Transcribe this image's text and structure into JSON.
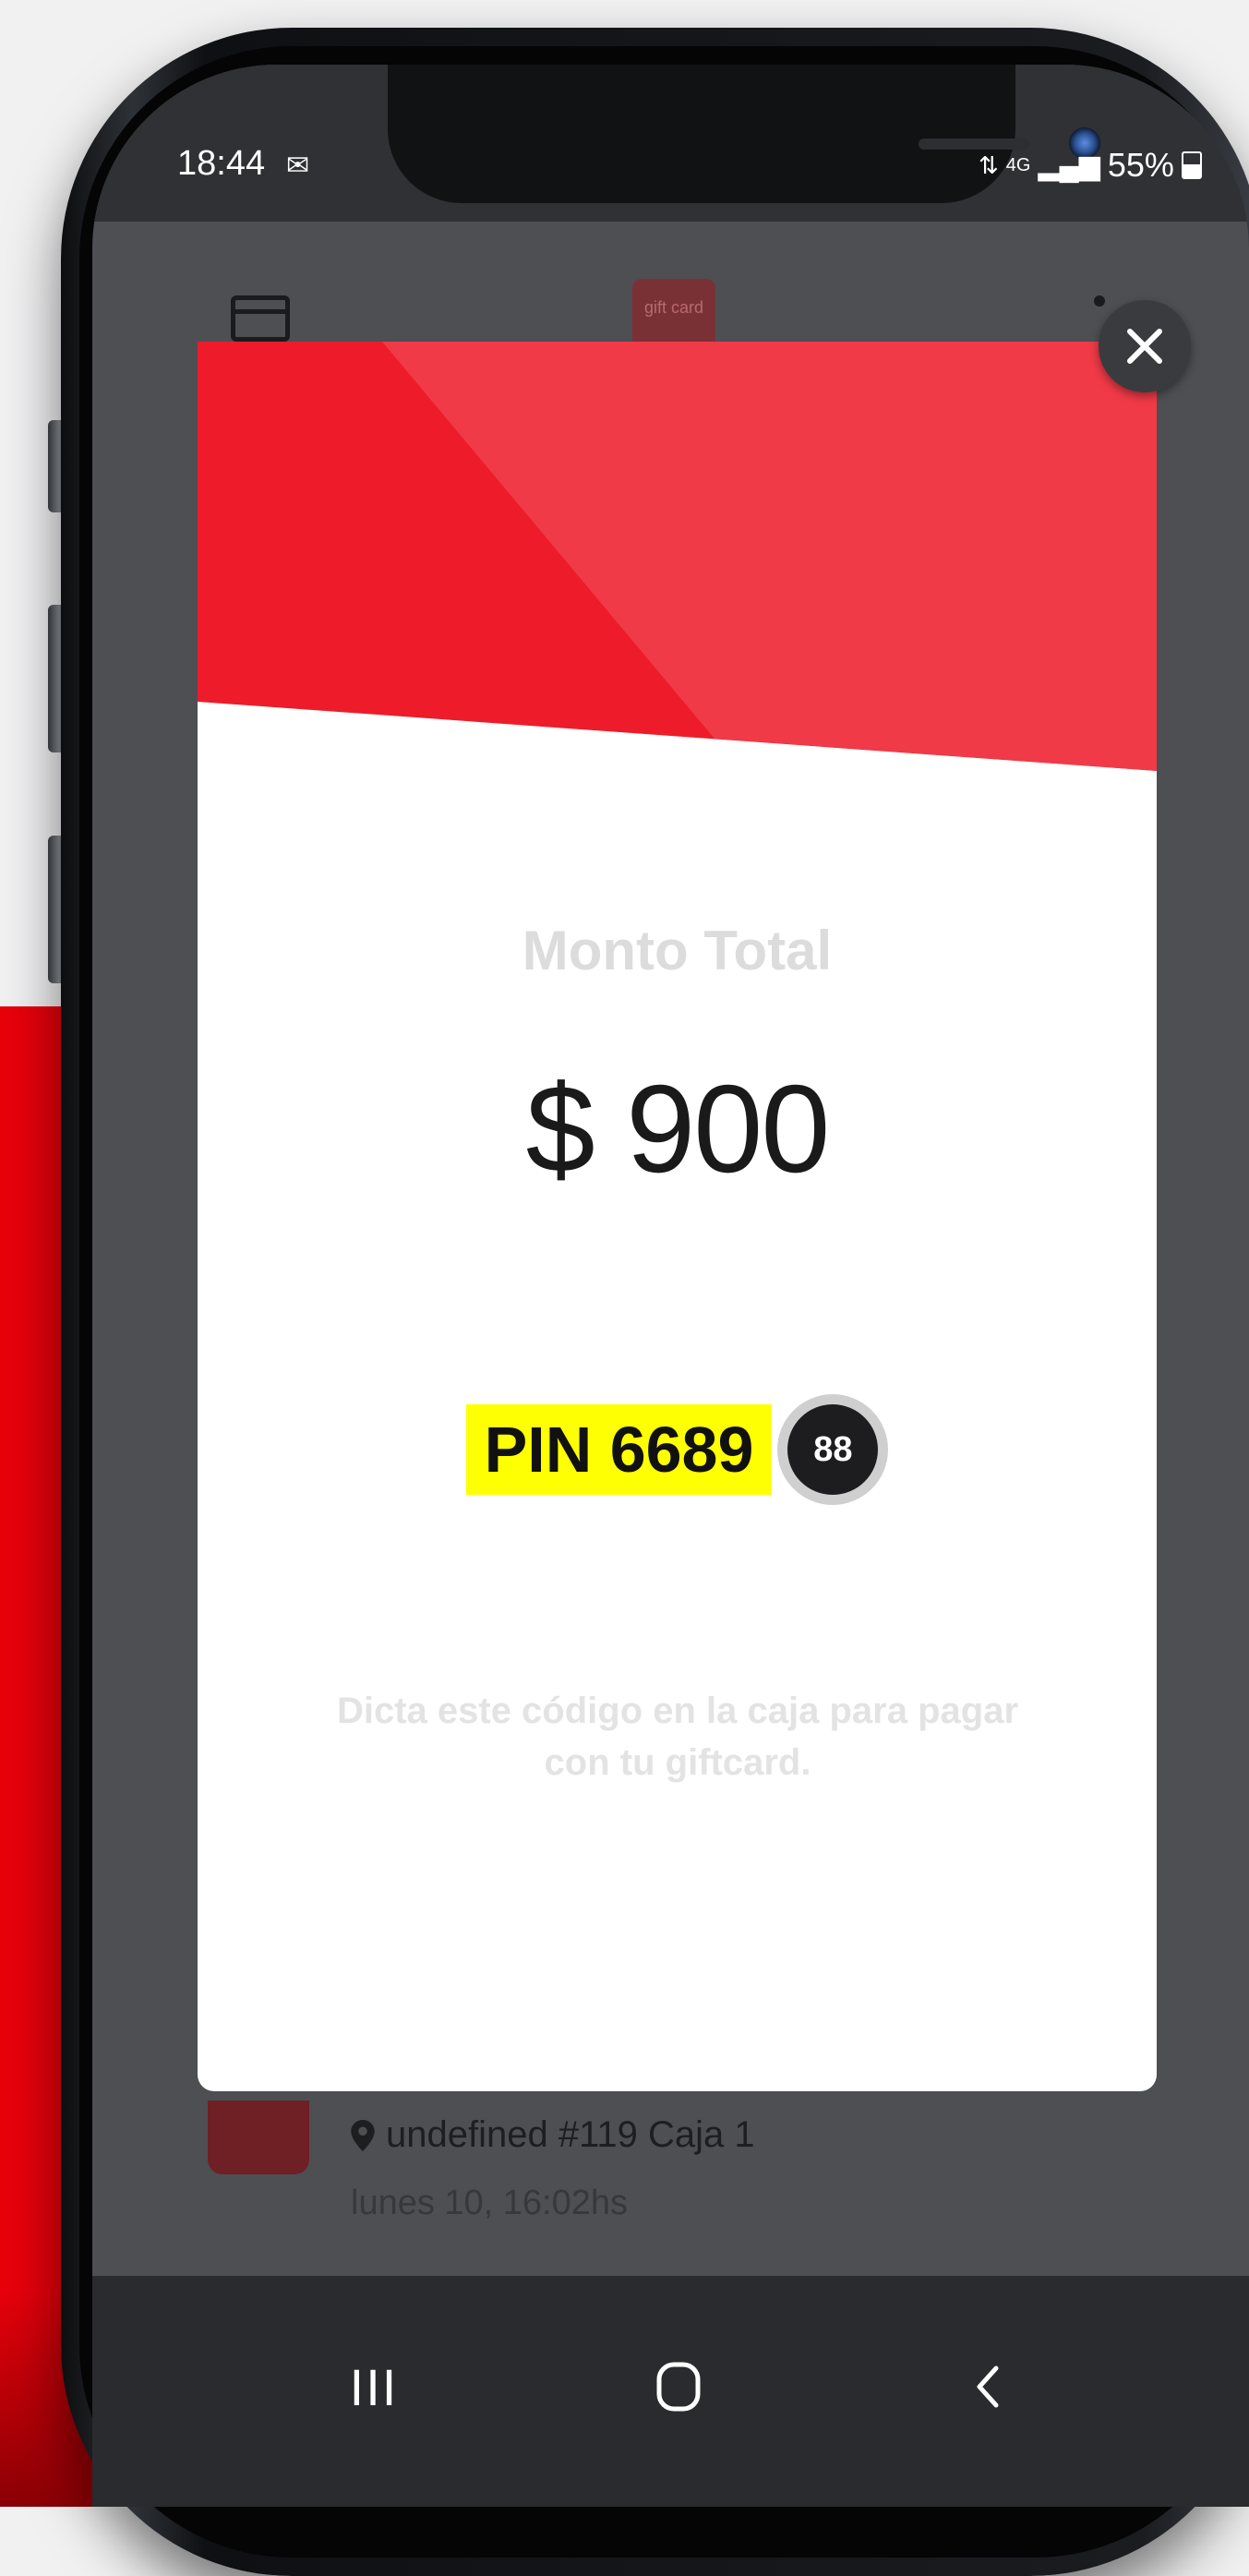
{
  "status_bar": {
    "time": "18:44",
    "battery": "55%",
    "network_label": "4G"
  },
  "app": {
    "logo_text": "gift card",
    "transaction": {
      "location": "undefined #119 Caja 1",
      "date": "lunes 10, 16:02hs"
    }
  },
  "modal": {
    "label": "Monto Total",
    "amount": "$ 900",
    "pin_label": "PIN 6689",
    "countdown": "88",
    "hint": "Dicta este código en la caja para pagar con tu giftcard."
  },
  "nav": {
    "recents_glyph": "III"
  },
  "colors": {
    "accent_red": "#e8000b",
    "modal_red": "#ee1c2a",
    "pin_highlight": "#ffff03"
  }
}
